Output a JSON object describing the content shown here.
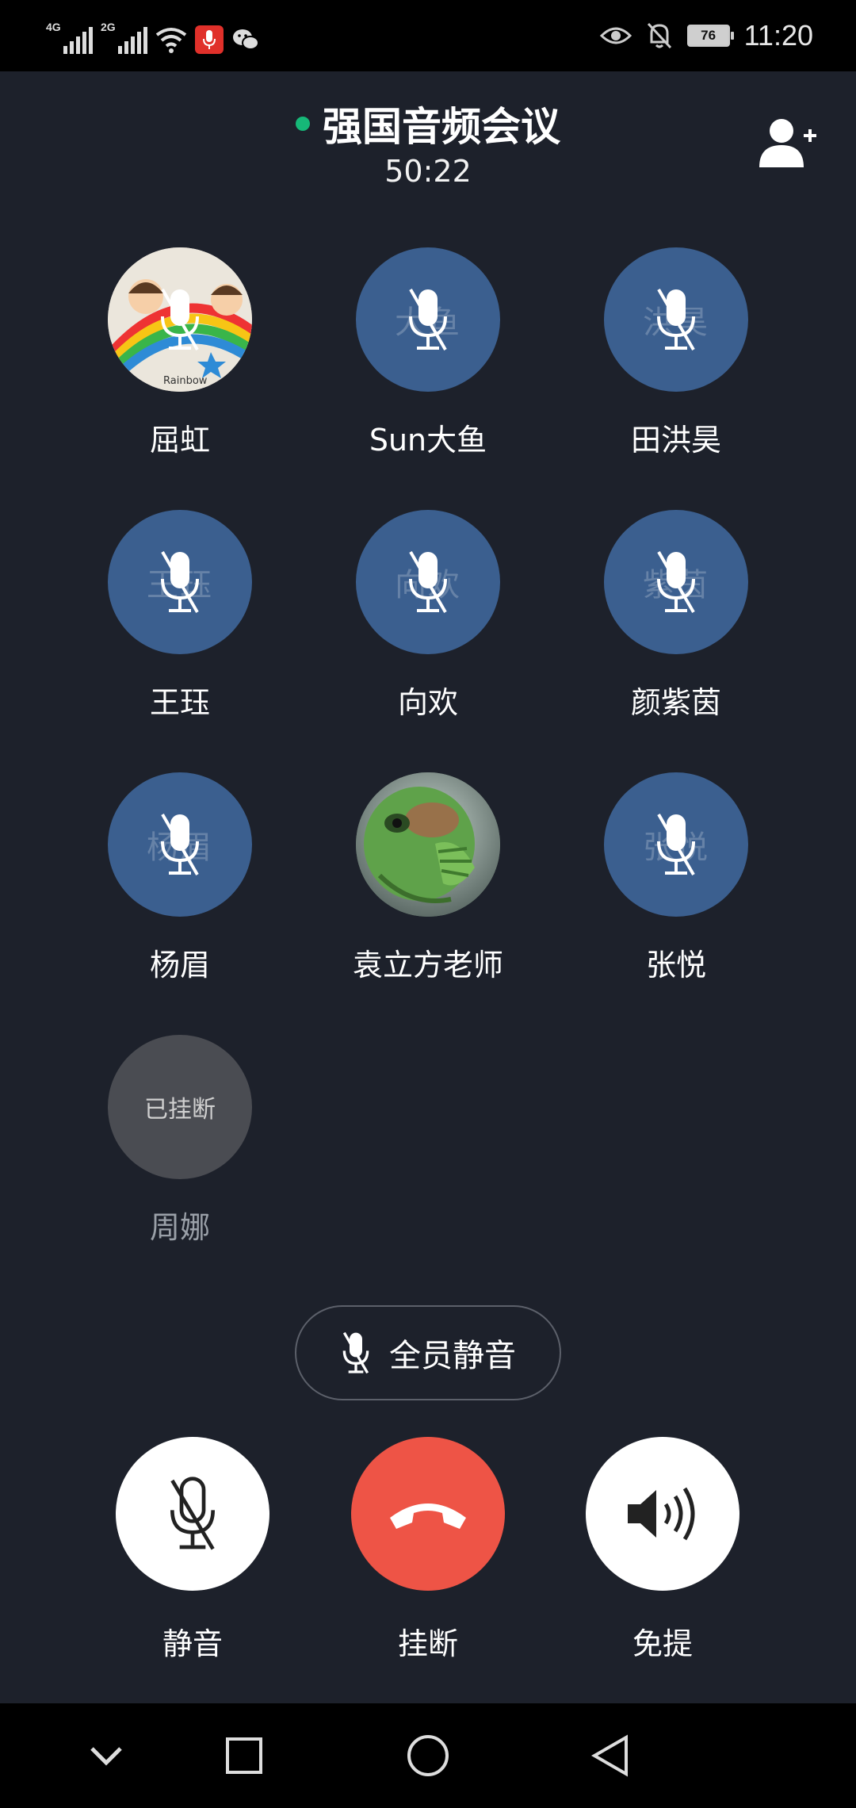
{
  "status_bar": {
    "network_1": "4G",
    "network_2": "2G",
    "battery": "76",
    "time": "11:20",
    "icons": [
      "signal-icon",
      "wifi-icon",
      "recording-mic-icon",
      "wechat-icon",
      "eye-icon",
      "bell-off-icon",
      "battery-icon"
    ]
  },
  "header": {
    "title": "强国音频会议",
    "timer": "50:22",
    "add_icon": "add-user-icon"
  },
  "members": [
    {
      "name": "屈虹",
      "initials": "",
      "muted": true,
      "avatar": "image"
    },
    {
      "name": "Sun大鱼",
      "initials": "大鱼",
      "muted": true,
      "avatar": "initials"
    },
    {
      "name": "田洪昊",
      "initials": "洪昊",
      "muted": true,
      "avatar": "initials"
    },
    {
      "name": "王珏",
      "initials": "王珏",
      "muted": true,
      "avatar": "initials"
    },
    {
      "name": "向欢",
      "initials": "向欢",
      "muted": true,
      "avatar": "initials"
    },
    {
      "name": "颜紫茵",
      "initials": "紫茵",
      "muted": true,
      "avatar": "initials"
    },
    {
      "name": "杨眉",
      "initials": "杨眉",
      "muted": true,
      "avatar": "initials"
    },
    {
      "name": "袁立方老师",
      "initials": "",
      "muted": false,
      "avatar": "image"
    },
    {
      "name": "张悦",
      "initials": "张悦",
      "muted": true,
      "avatar": "initials"
    },
    {
      "name": "周娜",
      "status": "已挂断",
      "muted": false,
      "avatar": "left"
    }
  ],
  "mute_all": {
    "label": "全员静音"
  },
  "controls": {
    "mute": "静音",
    "hangup": "挂断",
    "speaker": "免提"
  },
  "colors": {
    "background": "#1d212b",
    "avatar_blue": "#3b5f8f",
    "hangup_red": "#ee5446",
    "live_green": "#16b878"
  },
  "nav": [
    "chevron-down-icon",
    "recent-apps-icon",
    "home-icon",
    "back-icon"
  ]
}
